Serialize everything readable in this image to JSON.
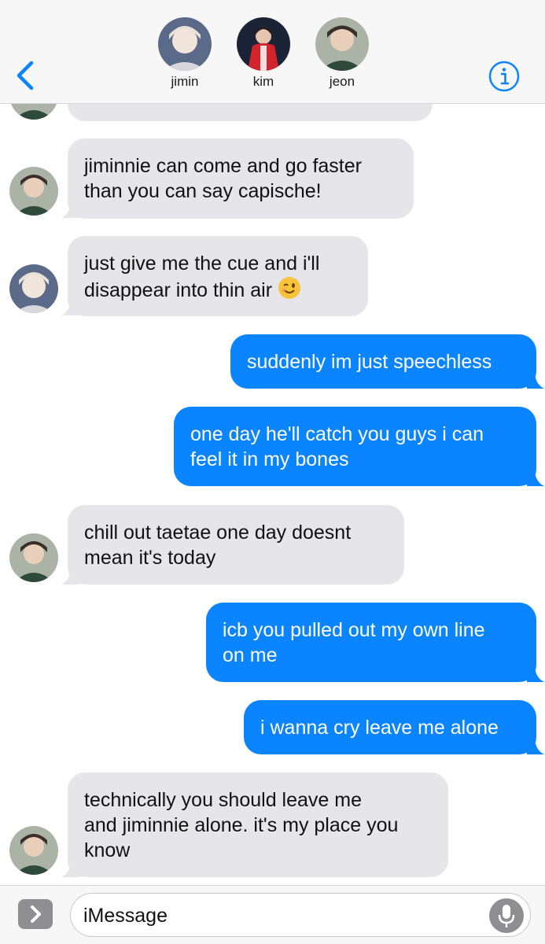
{
  "header": {
    "contacts": [
      {
        "name": "jimin"
      },
      {
        "name": "kim"
      },
      {
        "name": "jeon"
      }
    ],
    "back_icon": "chevron-left-icon",
    "info_icon": "info-icon",
    "accent_color": "#0a84ff"
  },
  "messages": [
    {
      "from": "jeon",
      "text": ""
    },
    {
      "from": "jeon",
      "text": "jiminnie can come and go faster\nthan you can say capische!"
    },
    {
      "from": "jimin",
      "text": "just give me the cue and i'll\ndisappear into thin air",
      "emoji": "winking-face"
    },
    {
      "from": "me",
      "text": "suddenly im just speechless"
    },
    {
      "from": "me",
      "text": "one day he'll catch you guys i can\nfeel it in my bones"
    },
    {
      "from": "jeon",
      "text": "chill out taetae one day doesnt\nmean it's today"
    },
    {
      "from": "me",
      "text": "icb you pulled out my own line\non me"
    },
    {
      "from": "me",
      "text": "i wanna cry leave me alone"
    },
    {
      "from": "jeon",
      "text": "technically you should leave me\nand jiminnie alone. it's my place you\nknow"
    }
  ],
  "compose": {
    "placeholder": "iMessage",
    "apps_icon": "chevron-right-icon",
    "mic_icon": "microphone-icon"
  }
}
